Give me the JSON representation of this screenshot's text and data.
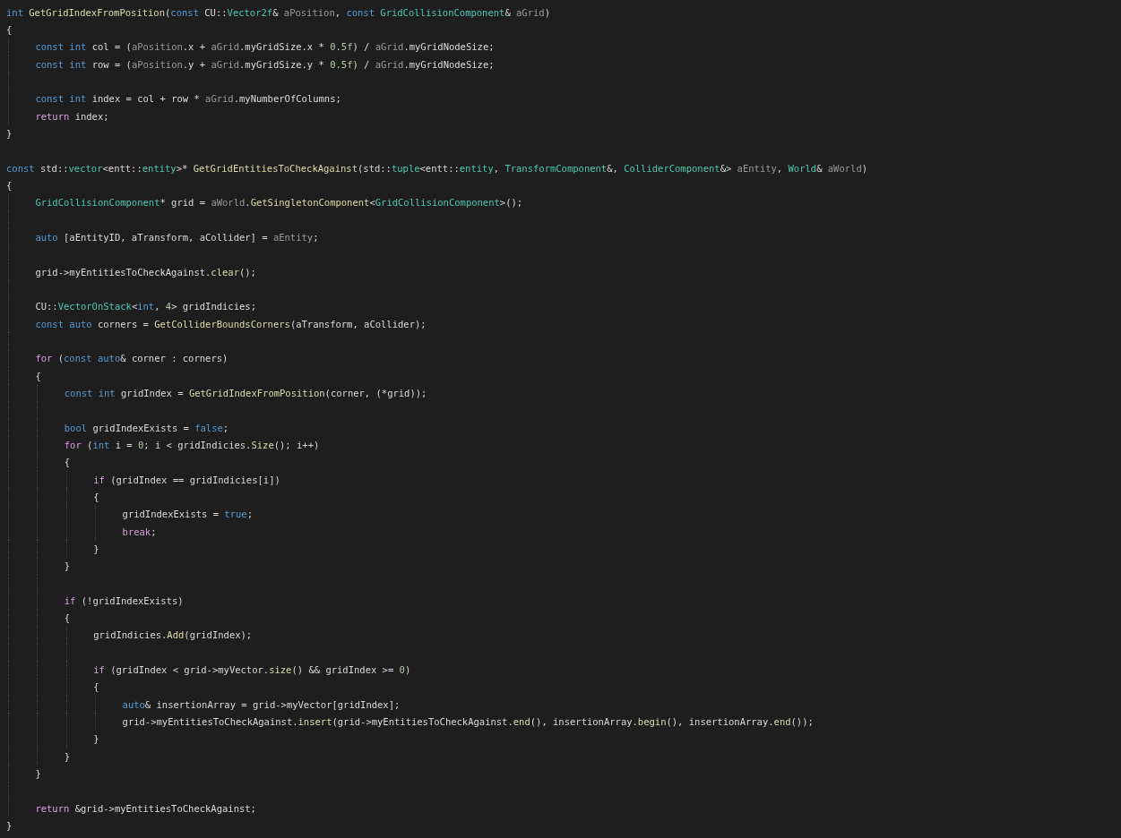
{
  "editor": {
    "lines": [
      {
        "kind": "code",
        "tokens": [
          {
            "text": "int ",
            "kind": "keyword"
          },
          {
            "text": "GetGridIndexFromPosition",
            "kind": "function"
          },
          {
            "text": "(",
            "kind": "plain"
          },
          {
            "text": "const ",
            "kind": "keyword"
          },
          {
            "text": "CU::",
            "kind": "plain"
          },
          {
            "text": "Vector2f",
            "kind": "type"
          },
          {
            "text": "& ",
            "kind": "plain"
          },
          {
            "text": "aPosition",
            "kind": "param"
          },
          {
            "text": ", ",
            "kind": "plain"
          },
          {
            "text": "const ",
            "kind": "keyword"
          },
          {
            "text": "GridCollisionComponent",
            "kind": "type"
          },
          {
            "text": "& ",
            "kind": "plain"
          },
          {
            "text": "aGrid",
            "kind": "param"
          },
          {
            "text": ")",
            "kind": "plain"
          }
        ]
      },
      {
        "kind": "code",
        "tokens": [
          {
            "text": "{",
            "kind": "plain"
          }
        ],
        "children": [
          {
            "kind": "code",
            "tokens": [
              {
                "text": "const ",
                "kind": "keyword"
              },
              {
                "text": "int ",
                "kind": "keyword"
              },
              {
                "text": "col = (",
                "kind": "plain"
              },
              {
                "text": "aPosition",
                "kind": "param"
              },
              {
                "text": ".x + ",
                "kind": "plain"
              },
              {
                "text": "aGrid",
                "kind": "param"
              },
              {
                "text": ".myGridSize.x * ",
                "kind": "plain"
              },
              {
                "text": "0.5f",
                "kind": "number"
              },
              {
                "text": ") / ",
                "kind": "plain"
              },
              {
                "text": "aGrid",
                "kind": "param"
              },
              {
                "text": ".myGridNodeSize;",
                "kind": "plain"
              }
            ]
          },
          {
            "kind": "code",
            "tokens": [
              {
                "text": "const ",
                "kind": "keyword"
              },
              {
                "text": "int ",
                "kind": "keyword"
              },
              {
                "text": "row = (",
                "kind": "plain"
              },
              {
                "text": "aPosition",
                "kind": "param"
              },
              {
                "text": ".y + ",
                "kind": "plain"
              },
              {
                "text": "aGrid",
                "kind": "param"
              },
              {
                "text": ".myGridSize.y * ",
                "kind": "plain"
              },
              {
                "text": "0.5f",
                "kind": "number"
              },
              {
                "text": ") / ",
                "kind": "plain"
              },
              {
                "text": "aGrid",
                "kind": "param"
              },
              {
                "text": ".myGridNodeSize;",
                "kind": "plain"
              }
            ]
          },
          {
            "kind": "blank"
          },
          {
            "kind": "code",
            "tokens": [
              {
                "text": "const ",
                "kind": "keyword"
              },
              {
                "text": "int ",
                "kind": "keyword"
              },
              {
                "text": "index = col + row * ",
                "kind": "plain"
              },
              {
                "text": "aGrid",
                "kind": "param"
              },
              {
                "text": ".myNumberOfColumns;",
                "kind": "plain"
              }
            ]
          },
          {
            "kind": "code",
            "tokens": [
              {
                "text": "return",
                "kind": "control"
              },
              {
                "text": " index;",
                "kind": "plain"
              }
            ]
          }
        ]
      },
      {
        "kind": "code",
        "tokens": [
          {
            "text": "}",
            "kind": "plain"
          }
        ]
      },
      {
        "kind": "blank"
      },
      {
        "kind": "code",
        "tokens": [
          {
            "text": "const ",
            "kind": "keyword"
          },
          {
            "text": "std::",
            "kind": "plain"
          },
          {
            "text": "vector",
            "kind": "type"
          },
          {
            "text": "<entt::",
            "kind": "plain"
          },
          {
            "text": "entity",
            "kind": "type"
          },
          {
            "text": ">* ",
            "kind": "plain"
          },
          {
            "text": "GetGridEntitiesToCheckAgainst",
            "kind": "function"
          },
          {
            "text": "(std::",
            "kind": "plain"
          },
          {
            "text": "tuple",
            "kind": "type"
          },
          {
            "text": "<entt::",
            "kind": "plain"
          },
          {
            "text": "entity",
            "kind": "type"
          },
          {
            "text": ", ",
            "kind": "plain"
          },
          {
            "text": "TransformComponent",
            "kind": "type"
          },
          {
            "text": "&, ",
            "kind": "plain"
          },
          {
            "text": "ColliderComponent",
            "kind": "type"
          },
          {
            "text": "&> ",
            "kind": "plain"
          },
          {
            "text": "aEntity",
            "kind": "param"
          },
          {
            "text": ", ",
            "kind": "plain"
          },
          {
            "text": "World",
            "kind": "type"
          },
          {
            "text": "& ",
            "kind": "plain"
          },
          {
            "text": "aWorld",
            "kind": "param"
          },
          {
            "text": ")",
            "kind": "plain"
          }
        ]
      },
      {
        "kind": "code",
        "tokens": [
          {
            "text": "{",
            "kind": "plain"
          }
        ],
        "children": [
          {
            "kind": "code",
            "tokens": [
              {
                "text": "GridCollisionComponent",
                "kind": "type"
              },
              {
                "text": "* grid = ",
                "kind": "plain"
              },
              {
                "text": "aWorld",
                "kind": "param"
              },
              {
                "text": ".",
                "kind": "plain"
              },
              {
                "text": "GetSingletonComponent",
                "kind": "function"
              },
              {
                "text": "<",
                "kind": "plain"
              },
              {
                "text": "GridCollisionComponent",
                "kind": "type"
              },
              {
                "text": ">();",
                "kind": "plain"
              }
            ]
          },
          {
            "kind": "blank"
          },
          {
            "kind": "code",
            "tokens": [
              {
                "text": "auto",
                "kind": "keyword"
              },
              {
                "text": " [aEntityID, aTransform, aCollider] = ",
                "kind": "plain"
              },
              {
                "text": "aEntity",
                "kind": "param"
              },
              {
                "text": ";",
                "kind": "plain"
              }
            ]
          },
          {
            "kind": "blank"
          },
          {
            "kind": "code",
            "tokens": [
              {
                "text": "grid->myEntitiesToCheckAgainst.",
                "kind": "plain"
              },
              {
                "text": "clear",
                "kind": "function"
              },
              {
                "text": "();",
                "kind": "plain"
              }
            ]
          },
          {
            "kind": "blank"
          },
          {
            "kind": "code",
            "tokens": [
              {
                "text": "CU::",
                "kind": "plain"
              },
              {
                "text": "VectorOnStack",
                "kind": "type"
              },
              {
                "text": "<",
                "kind": "plain"
              },
              {
                "text": "int",
                "kind": "keyword"
              },
              {
                "text": ", ",
                "kind": "plain"
              },
              {
                "text": "4",
                "kind": "number"
              },
              {
                "text": "> gridIndicies;",
                "kind": "plain"
              }
            ]
          },
          {
            "kind": "code",
            "tokens": [
              {
                "text": "const ",
                "kind": "keyword"
              },
              {
                "text": "auto",
                "kind": "keyword"
              },
              {
                "text": " corners = ",
                "kind": "plain"
              },
              {
                "text": "GetColliderBoundsCorners",
                "kind": "function"
              },
              {
                "text": "(aTransform, aCollider);",
                "kind": "plain"
              }
            ]
          },
          {
            "kind": "blank"
          },
          {
            "kind": "code",
            "tokens": [
              {
                "text": "for",
                "kind": "control"
              },
              {
                "text": " (",
                "kind": "plain"
              },
              {
                "text": "const ",
                "kind": "keyword"
              },
              {
                "text": "auto",
                "kind": "keyword"
              },
              {
                "text": "& corner : corners)",
                "kind": "plain"
              }
            ]
          },
          {
            "kind": "code",
            "tokens": [
              {
                "text": "{",
                "kind": "plain"
              }
            ],
            "children": [
              {
                "kind": "code",
                "tokens": [
                  {
                    "text": "const ",
                    "kind": "keyword"
                  },
                  {
                    "text": "int ",
                    "kind": "keyword"
                  },
                  {
                    "text": "gridIndex = ",
                    "kind": "plain"
                  },
                  {
                    "text": "GetGridIndexFromPosition",
                    "kind": "function"
                  },
                  {
                    "text": "(corner, (*grid));",
                    "kind": "plain"
                  }
                ]
              },
              {
                "kind": "blank"
              },
              {
                "kind": "code",
                "tokens": [
                  {
                    "text": "bool",
                    "kind": "keyword"
                  },
                  {
                    "text": " gridIndexExists = ",
                    "kind": "plain"
                  },
                  {
                    "text": "false",
                    "kind": "keyword"
                  },
                  {
                    "text": ";",
                    "kind": "plain"
                  }
                ]
              },
              {
                "kind": "code",
                "tokens": [
                  {
                    "text": "for",
                    "kind": "control"
                  },
                  {
                    "text": " (",
                    "kind": "plain"
                  },
                  {
                    "text": "int",
                    "kind": "keyword"
                  },
                  {
                    "text": " i = ",
                    "kind": "plain"
                  },
                  {
                    "text": "0",
                    "kind": "number"
                  },
                  {
                    "text": "; i < gridIndicies.",
                    "kind": "plain"
                  },
                  {
                    "text": "Size",
                    "kind": "function"
                  },
                  {
                    "text": "(); i++)",
                    "kind": "plain"
                  }
                ]
              },
              {
                "kind": "code",
                "tokens": [
                  {
                    "text": "{",
                    "kind": "plain"
                  }
                ],
                "children": [
                  {
                    "kind": "code",
                    "tokens": [
                      {
                        "text": "if",
                        "kind": "control"
                      },
                      {
                        "text": " (gridIndex == gridIndicies[i])",
                        "kind": "plain"
                      }
                    ]
                  },
                  {
                    "kind": "code",
                    "tokens": [
                      {
                        "text": "{",
                        "kind": "plain"
                      }
                    ],
                    "children": [
                      {
                        "kind": "code",
                        "tokens": [
                          {
                            "text": "gridIndexExists = ",
                            "kind": "plain"
                          },
                          {
                            "text": "true",
                            "kind": "keyword"
                          },
                          {
                            "text": ";",
                            "kind": "plain"
                          }
                        ]
                      },
                      {
                        "kind": "code",
                        "tokens": [
                          {
                            "text": "break",
                            "kind": "control"
                          },
                          {
                            "text": ";",
                            "kind": "plain"
                          }
                        ]
                      }
                    ]
                  },
                  {
                    "kind": "code",
                    "tokens": [
                      {
                        "text": "}",
                        "kind": "plain"
                      }
                    ]
                  }
                ]
              },
              {
                "kind": "code",
                "tokens": [
                  {
                    "text": "}",
                    "kind": "plain"
                  }
                ]
              },
              {
                "kind": "blank"
              },
              {
                "kind": "code",
                "tokens": [
                  {
                    "text": "if",
                    "kind": "control"
                  },
                  {
                    "text": " (!gridIndexExists)",
                    "kind": "plain"
                  }
                ]
              },
              {
                "kind": "code",
                "tokens": [
                  {
                    "text": "{",
                    "kind": "plain"
                  }
                ],
                "children": [
                  {
                    "kind": "code",
                    "tokens": [
                      {
                        "text": "gridIndicies.",
                        "kind": "plain"
                      },
                      {
                        "text": "Add",
                        "kind": "function"
                      },
                      {
                        "text": "(gridIndex);",
                        "kind": "plain"
                      }
                    ]
                  },
                  {
                    "kind": "blank"
                  },
                  {
                    "kind": "code",
                    "tokens": [
                      {
                        "text": "if",
                        "kind": "control"
                      },
                      {
                        "text": " (gridIndex < grid->myVector.",
                        "kind": "plain"
                      },
                      {
                        "text": "size",
                        "kind": "function"
                      },
                      {
                        "text": "() && gridIndex >= ",
                        "kind": "plain"
                      },
                      {
                        "text": "0",
                        "kind": "number"
                      },
                      {
                        "text": ")",
                        "kind": "plain"
                      }
                    ]
                  },
                  {
                    "kind": "code",
                    "tokens": [
                      {
                        "text": "{",
                        "kind": "plain"
                      }
                    ],
                    "children": [
                      {
                        "kind": "code",
                        "tokens": [
                          {
                            "text": "auto",
                            "kind": "keyword"
                          },
                          {
                            "text": "& insertionArray = grid->myVector[gridIndex];",
                            "kind": "plain"
                          }
                        ]
                      },
                      {
                        "kind": "code",
                        "tokens": [
                          {
                            "text": "grid->myEntitiesToCheckAgainst.",
                            "kind": "plain"
                          },
                          {
                            "text": "insert",
                            "kind": "function"
                          },
                          {
                            "text": "(grid->myEntitiesToCheckAgainst.",
                            "kind": "plain"
                          },
                          {
                            "text": "end",
                            "kind": "function"
                          },
                          {
                            "text": "(), insertionArray.",
                            "kind": "plain"
                          },
                          {
                            "text": "begin",
                            "kind": "function"
                          },
                          {
                            "text": "(), insertionArray.",
                            "kind": "plain"
                          },
                          {
                            "text": "end",
                            "kind": "function"
                          },
                          {
                            "text": "());",
                            "kind": "plain"
                          }
                        ]
                      }
                    ]
                  },
                  {
                    "kind": "code",
                    "tokens": [
                      {
                        "text": "}",
                        "kind": "plain"
                      }
                    ]
                  }
                ]
              },
              {
                "kind": "code",
                "tokens": [
                  {
                    "text": "}",
                    "kind": "plain"
                  }
                ]
              }
            ]
          },
          {
            "kind": "code",
            "tokens": [
              {
                "text": "}",
                "kind": "plain"
              }
            ]
          },
          {
            "kind": "blank"
          },
          {
            "kind": "code",
            "tokens": [
              {
                "text": "return",
                "kind": "control"
              },
              {
                "text": " &grid->myEntitiesToCheckAgainst;",
                "kind": "plain"
              }
            ]
          }
        ]
      },
      {
        "kind": "code",
        "tokens": [
          {
            "text": "}",
            "kind": "plain"
          }
        ]
      }
    ]
  }
}
